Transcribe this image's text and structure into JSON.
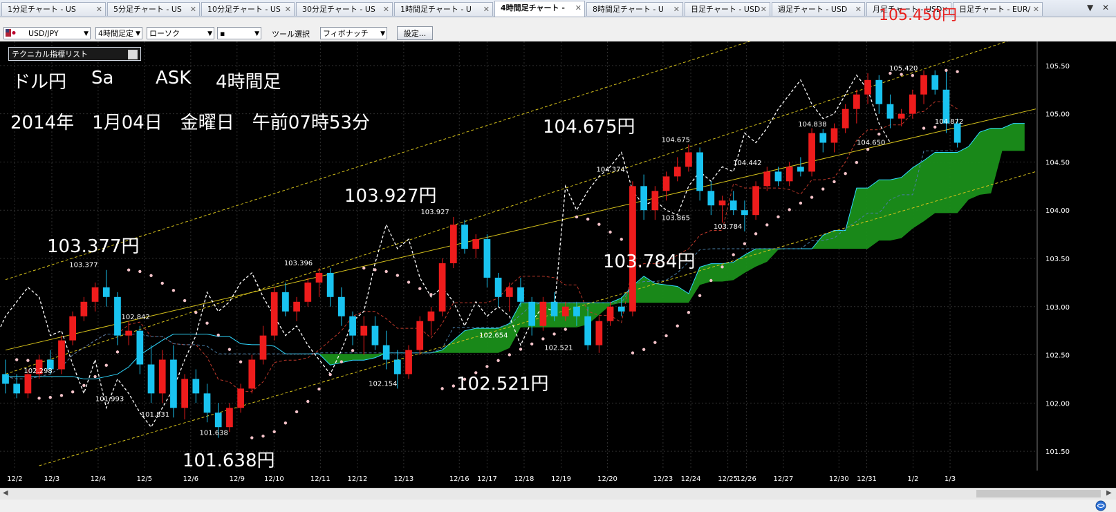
{
  "tabs": [
    {
      "label": "1分足チャート - US"
    },
    {
      "label": "5分足チャート - US"
    },
    {
      "label": "10分足チャート - US"
    },
    {
      "label": "30分足チャート - US"
    },
    {
      "label": "1時間足チャート - U"
    },
    {
      "label": "4時間足チャート -",
      "active": true
    },
    {
      "label": "8時間足チャート - U"
    },
    {
      "label": "日足チャート - USD"
    },
    {
      "label": "週足チャート - USD"
    },
    {
      "label": "月足チャート - USD"
    },
    {
      "label": "日足チャート - EUR/"
    }
  ],
  "toolbar": {
    "pair": "USD/JPY",
    "timeframe": "4時間足定",
    "chart_type": "ローソク",
    "style": "▪",
    "tool_label": "ツール選択",
    "tool_value": "フィボナッチ",
    "settings_label": "設定..."
  },
  "current_price": "105.450円",
  "indicator_list_label": "テクニカル指標リスト",
  "overlay": {
    "title_pair": "ドル円",
    "title_sa": "Sa",
    "title_ask": "ASK",
    "title_tf": "4時間足",
    "datetime": "2014年　1月04日　金曜日　午前07時53分"
  },
  "chart_data": {
    "type": "line",
    "title": "",
    "xlabel": "",
    "ylabel": "",
    "ylim": [
      101.3,
      105.75
    ],
    "grid": true,
    "yticks": [
      "105.50",
      "105.00",
      "104.50",
      "104.00",
      "103.50",
      "103.00",
      "102.50",
      "102.00",
      "101.50"
    ],
    "x_labels": [
      "12/2",
      "12/3",
      "12/4",
      "12/5",
      "12/6",
      "12/9",
      "12/10",
      "12/11",
      "12/12",
      "12/13",
      "12/16",
      "12/17",
      "12/18",
      "12/19",
      "12/20",
      "12/23",
      "12/24",
      "12/25",
      "12/26",
      "12/27",
      "12/30",
      "12/31",
      "1/2",
      "1/3"
    ],
    "x_label_index": [
      1,
      5,
      10,
      15,
      20,
      25,
      29,
      34,
      38,
      43,
      49,
      52,
      56,
      60,
      65,
      71,
      74,
      78,
      80,
      84,
      90,
      93,
      98,
      102
    ],
    "series": [
      {
        "type": "candlestick",
        "ohlc": [
          [
            102.3,
            102.45,
            102.1,
            102.2
          ],
          [
            102.2,
            102.3,
            102.05,
            102.1
          ],
          [
            102.1,
            102.35,
            102.05,
            102.3
          ],
          [
            102.3,
            102.5,
            102.25,
            102.45
          ],
          [
            102.45,
            102.55,
            102.3,
            102.35
          ],
          [
            102.35,
            102.7,
            102.3,
            102.65
          ],
          [
            102.65,
            102.95,
            102.6,
            102.9
          ],
          [
            102.9,
            103.1,
            102.85,
            103.05
          ],
          [
            103.05,
            103.25,
            102.95,
            103.2
          ],
          [
            103.2,
            103.38,
            103.0,
            103.1
          ],
          [
            103.1,
            103.15,
            102.6,
            102.7
          ],
          [
            102.7,
            102.85,
            102.6,
            102.75
          ],
          [
            102.75,
            102.8,
            102.3,
            102.4
          ],
          [
            102.4,
            102.6,
            102.0,
            102.1
          ],
          [
            102.1,
            102.55,
            102.0,
            102.45
          ],
          [
            102.45,
            102.6,
            101.85,
            101.95
          ],
          [
            101.95,
            102.3,
            101.83,
            102.25
          ],
          [
            102.25,
            102.35,
            102.0,
            102.1
          ],
          [
            102.1,
            102.2,
            101.8,
            101.9
          ],
          [
            101.9,
            102.0,
            101.64,
            101.75
          ],
          [
            101.75,
            102.0,
            101.7,
            101.95
          ],
          [
            101.95,
            102.2,
            101.9,
            102.15
          ],
          [
            102.15,
            102.5,
            102.1,
            102.45
          ],
          [
            102.45,
            102.8,
            102.4,
            102.7
          ],
          [
            102.7,
            103.2,
            102.65,
            103.15
          ],
          [
            103.15,
            103.25,
            102.9,
            102.95
          ],
          [
            102.95,
            103.1,
            102.85,
            103.05
          ],
          [
            103.05,
            103.3,
            103.0,
            103.25
          ],
          [
            103.25,
            103.4,
            103.1,
            103.35
          ],
          [
            103.35,
            103.4,
            103.0,
            103.1
          ],
          [
            103.1,
            103.2,
            102.8,
            102.9
          ],
          [
            102.9,
            102.95,
            102.6,
            102.7
          ],
          [
            102.7,
            102.9,
            102.5,
            102.8
          ],
          [
            102.8,
            102.9,
            102.55,
            102.6
          ],
          [
            102.6,
            102.75,
            102.35,
            102.45
          ],
          [
            102.45,
            102.55,
            102.15,
            102.3
          ],
          [
            102.3,
            102.6,
            102.25,
            102.55
          ],
          [
            102.55,
            102.9,
            102.5,
            102.85
          ],
          [
            102.85,
            103.0,
            102.7,
            102.95
          ],
          [
            102.95,
            103.5,
            102.9,
            103.45
          ],
          [
            103.45,
            103.93,
            103.4,
            103.85
          ],
          [
            103.85,
            103.9,
            103.55,
            103.6
          ],
          [
            103.6,
            103.75,
            103.5,
            103.7
          ],
          [
            103.7,
            103.75,
            103.2,
            103.3
          ],
          [
            103.3,
            103.35,
            103.0,
            103.1
          ],
          [
            103.1,
            103.25,
            102.95,
            103.2
          ],
          [
            103.2,
            103.3,
            103.0,
            103.05
          ],
          [
            103.05,
            103.1,
            102.7,
            102.8
          ],
          [
            102.8,
            103.1,
            102.75,
            103.05
          ],
          [
            103.05,
            103.15,
            102.85,
            102.9
          ],
          [
            102.9,
            103.05,
            102.85,
            103.0
          ],
          [
            103.0,
            103.05,
            102.8,
            102.9
          ],
          [
            102.9,
            103.0,
            102.55,
            102.6
          ],
          [
            102.6,
            102.9,
            102.52,
            102.85
          ],
          [
            102.85,
            103.05,
            102.8,
            103.0
          ],
          [
            103.0,
            103.1,
            102.9,
            102.95
          ],
          [
            102.95,
            104.3,
            102.9,
            104.25
          ],
          [
            104.25,
            104.37,
            103.9,
            104.0
          ],
          [
            104.0,
            104.25,
            103.9,
            104.2
          ],
          [
            104.2,
            104.4,
            104.1,
            104.35
          ],
          [
            104.35,
            104.55,
            104.3,
            104.45
          ],
          [
            104.45,
            104.68,
            104.4,
            104.6
          ],
          [
            104.6,
            104.65,
            104.1,
            104.2
          ],
          [
            104.2,
            104.3,
            103.95,
            104.05
          ],
          [
            104.05,
            104.15,
            103.87,
            104.1
          ],
          [
            104.1,
            104.2,
            103.95,
            104.0
          ],
          [
            104.0,
            104.1,
            103.78,
            103.95
          ],
          [
            103.95,
            104.3,
            103.9,
            104.25
          ],
          [
            104.25,
            104.45,
            104.2,
            104.4
          ],
          [
            104.4,
            104.45,
            104.25,
            104.3
          ],
          [
            104.3,
            104.5,
            104.25,
            104.45
          ],
          [
            104.45,
            104.55,
            104.35,
            104.4
          ],
          [
            104.4,
            104.85,
            104.35,
            104.8
          ],
          [
            104.8,
            104.84,
            104.6,
            104.7
          ],
          [
            104.7,
            104.9,
            104.6,
            104.85
          ],
          [
            104.85,
            105.1,
            104.8,
            105.05
          ],
          [
            105.05,
            105.25,
            104.9,
            105.2
          ],
          [
            105.2,
            105.42,
            105.1,
            105.35
          ],
          [
            105.35,
            105.4,
            105.0,
            105.1
          ],
          [
            105.1,
            105.2,
            104.85,
            104.95
          ],
          [
            104.95,
            105.05,
            104.87,
            105.0
          ],
          [
            105.0,
            105.25,
            104.95,
            105.2
          ],
          [
            105.2,
            105.45,
            105.1,
            105.4
          ],
          [
            105.4,
            105.45,
            105.2,
            105.25
          ],
          [
            105.25,
            105.44,
            104.8,
            104.9
          ],
          [
            104.9,
            104.95,
            104.65,
            104.7
          ]
        ]
      }
    ],
    "annotations": [
      {
        "text": "103.377",
        "x": 24,
        "y": 103.38
      },
      {
        "text": "102.842",
        "x": 40,
        "y": 102.84
      },
      {
        "text": "101.993",
        "x": 32,
        "y": 101.99
      },
      {
        "text": "101.831",
        "x": 46,
        "y": 101.83
      },
      {
        "text": "101.638",
        "x": 64,
        "y": 101.64
      },
      {
        "text": "102.298",
        "x": 10,
        "y": 102.28
      },
      {
        "text": "103.396",
        "x": 90,
        "y": 103.4
      },
      {
        "text": "102.154",
        "x": 116,
        "y": 102.15
      },
      {
        "text": "103.927",
        "x": 132,
        "y": 103.93
      },
      {
        "text": "102.654",
        "x": 150,
        "y": 102.65
      },
      {
        "text": "102.521",
        "x": 170,
        "y": 102.52
      },
      {
        "text": "104.374",
        "x": 186,
        "y": 104.37
      },
      {
        "text": "104.675",
        "x": 206,
        "y": 104.68
      },
      {
        "text": "103.865",
        "x": 206,
        "y": 103.87
      },
      {
        "text": "103.784",
        "x": 222,
        "y": 103.78
      },
      {
        "text": "104.442",
        "x": 228,
        "y": 104.44
      },
      {
        "text": "104.838",
        "x": 248,
        "y": 104.84
      },
      {
        "text": "104.650",
        "x": 266,
        "y": 104.65
      },
      {
        "text": "105.420",
        "x": 276,
        "y": 105.42
      },
      {
        "text": "104.872",
        "x": 290,
        "y": 104.87
      }
    ],
    "callouts": [
      {
        "text": "103.377円"
      },
      {
        "text": "103.927円"
      },
      {
        "text": "104.675円"
      },
      {
        "text": "103.784円"
      },
      {
        "text": "102.521円"
      },
      {
        "text": "101.638円"
      }
    ]
  },
  "colors": {
    "background": "#000000",
    "bull": "#ee1c1c",
    "bear": "#19c3f0",
    "cloud": "#1a8f1a",
    "channel": "#d6c21b",
    "parabolic": "#f5c3c9",
    "chikou": "#ffffff"
  },
  "icons": {
    "flag": "us-jp-flag-icon",
    "menu": "chevron-down-icon"
  }
}
